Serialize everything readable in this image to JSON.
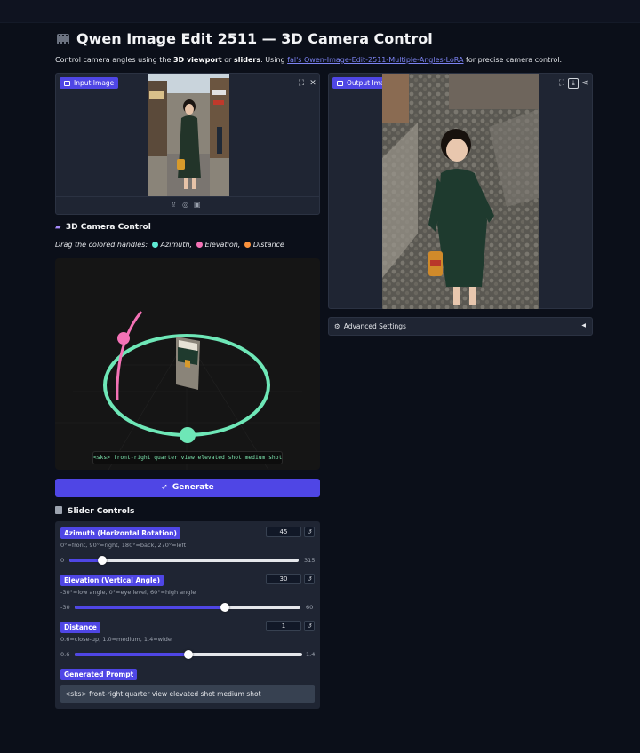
{
  "header": {
    "title": "Qwen Image Edit 2511 — 3D Camera Control",
    "subtitle_pre": "Control camera angles using the ",
    "subtitle_bold1": "3D viewport",
    "subtitle_mid": " or ",
    "subtitle_bold2": "sliders",
    "subtitle_mid2": ". Using ",
    "subtitle_link": "fal's Qwen-Image-Edit-2511-Multiple-Angles-LoRA",
    "subtitle_post": " for precise camera control."
  },
  "input_image": {
    "label": "Input Image"
  },
  "output_image": {
    "label": "Output Image"
  },
  "camera_control": {
    "title": "3D Camera Control",
    "instructions": "Drag the colored handles:",
    "handles": [
      {
        "label": "Azimuth,",
        "color": "#5eead4"
      },
      {
        "label": "Elevation,",
        "color": "#f472b6"
      },
      {
        "label": "Distance",
        "color": "#fb923c"
      }
    ],
    "prompt_overlay": "<sks> front-right quarter view elevated shot medium shot"
  },
  "generate_button": {
    "label": "Generate"
  },
  "slider_controls": {
    "title": "Slider Controls",
    "azimuth": {
      "label": "Azimuth (Horizontal Rotation)",
      "hint": "0°=front, 90°=right, 180°=back, 270°=left",
      "value": "45",
      "min": "0",
      "max": "315",
      "fraction": 0.143
    },
    "elevation": {
      "label": "Elevation (Vertical Angle)",
      "hint": "-30°=low angle, 0°=eye level, 60°=high angle",
      "value": "30",
      "min": "-30",
      "max": "60",
      "fraction": 0.667
    },
    "distance": {
      "label": "Distance",
      "hint": "0.6=close-up, 1.0=medium, 1.4=wide",
      "value": "1",
      "min": "0.6",
      "max": "1.4",
      "fraction": 0.5
    },
    "generated_prompt_label": "Generated Prompt",
    "generated_prompt_value": "<sks> front-right quarter view elevated shot medium shot"
  },
  "advanced_settings": {
    "label": "Advanced Settings"
  },
  "colors": {
    "accent": "#4f46e5",
    "background": "#0b0f19",
    "panel": "#1f2533",
    "azimuth_ring": "#6ee7b7",
    "elevation_arc": "#f472b6"
  }
}
